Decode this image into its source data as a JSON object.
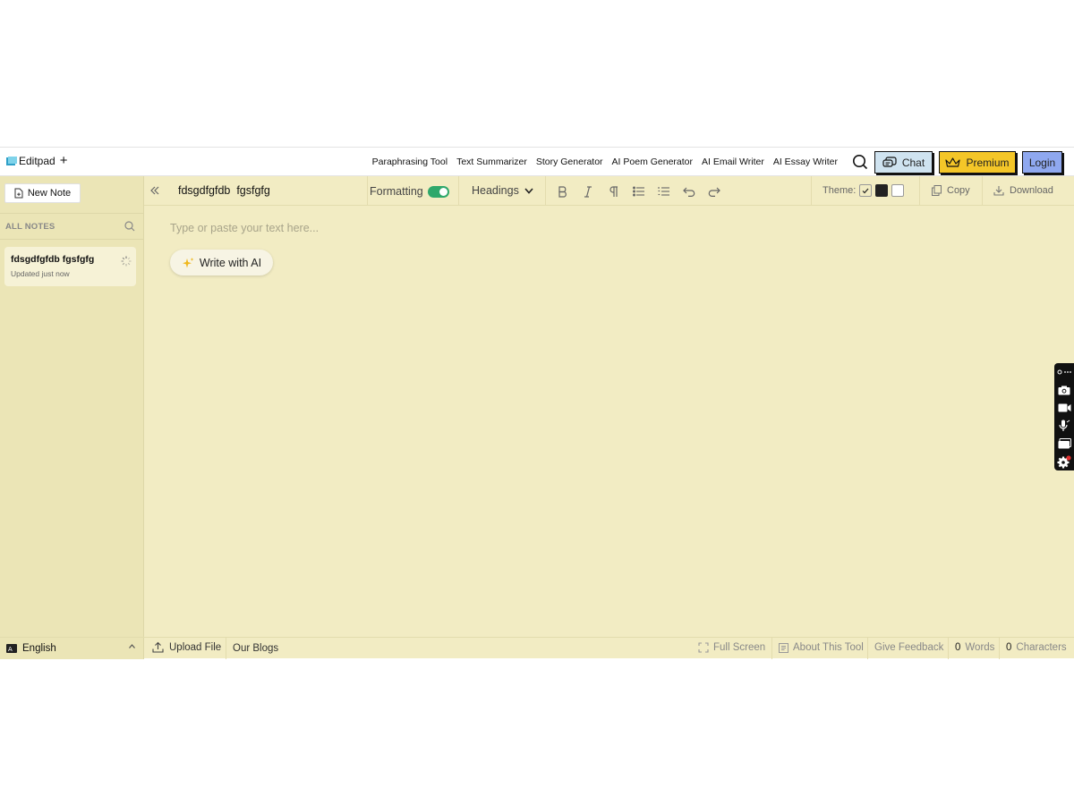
{
  "brand": {
    "name": "Editpad",
    "plus": "+"
  },
  "nav": {
    "links": [
      "Paraphrasing Tool",
      "Text Summarizer",
      "Story Generator",
      "AI Poem Generator",
      "AI Email Writer",
      "AI Essay Writer"
    ],
    "chat_label": "Chat",
    "premium_label": "Premium",
    "login_label": "Login"
  },
  "sidebar": {
    "new_note_label": "New Note",
    "all_notes_label": "ALL NOTES",
    "notes": [
      {
        "title": "fdsgdfgfdb fgsfgfg",
        "updated": "Updated just now"
      }
    ]
  },
  "toolbar": {
    "doc_title": "fdsgdfgfdb  fgsfgfg",
    "formatting_label": "Formatting",
    "formatting_on": true,
    "headings_label": "Headings",
    "theme_label": "Theme:",
    "copy_label": "Copy",
    "download_label": "Download"
  },
  "editor": {
    "placeholder": "Type or paste your text here...",
    "write_ai_label": "Write with AI"
  },
  "footer": {
    "language": "English",
    "language_icon_text": "A",
    "upload_label": "Upload File",
    "blogs_label": "Our Blogs",
    "fullscreen_label": "Full Screen",
    "about_label": "About This Tool",
    "feedback_label": "Give Feedback",
    "words_count": "0",
    "words_label": "Words",
    "chars_count": "0",
    "chars_label": "Characters"
  },
  "colors": {
    "editor_bg": "#f2ecc3",
    "sidebar_bg": "#ebe5b6",
    "chat_bg": "#cfe3f0",
    "premium_bg": "#f4c628",
    "login_bg": "#8fa8ef",
    "toggle_on": "#2fa86b"
  }
}
